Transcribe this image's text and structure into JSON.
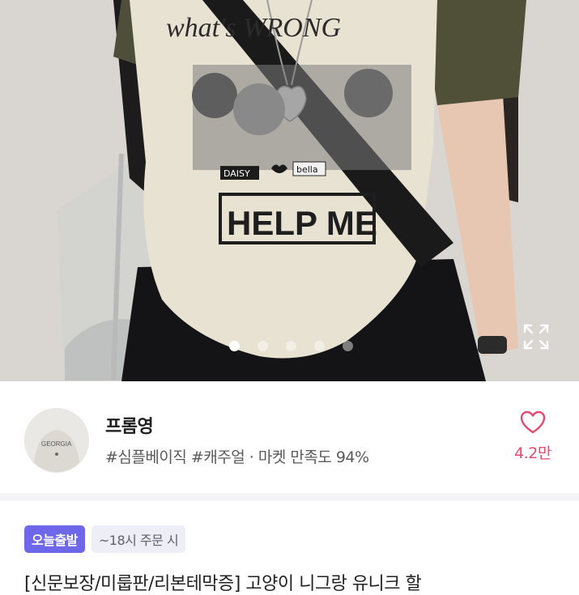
{
  "hero": {
    "shirt_text_top": "what's WRONG",
    "shirt_text_help": "HELP ME",
    "shirt_label_daisy": "DAISY",
    "shirt_label_bella": "bella",
    "carousel_total": 5,
    "carousel_active": 1,
    "expand_icon": "expand-icon"
  },
  "shop": {
    "name": "프롬영",
    "tags": "#심플베이직 #캐주얼 · 마켓 만족도 94%",
    "like_icon": "heart-icon",
    "like_count": "4.2만",
    "avatar_text": "GEORGIA"
  },
  "badges": {
    "today_ship": "오늘출발",
    "order_deadline": "~18시 주문 시"
  },
  "product": {
    "title": "[신문보장/미룹판/리본테막증] 고양이 니그랑 유니크 할"
  },
  "colors": {
    "accent_purple": "#6f67e9",
    "heart_pink": "#e84a6f"
  }
}
